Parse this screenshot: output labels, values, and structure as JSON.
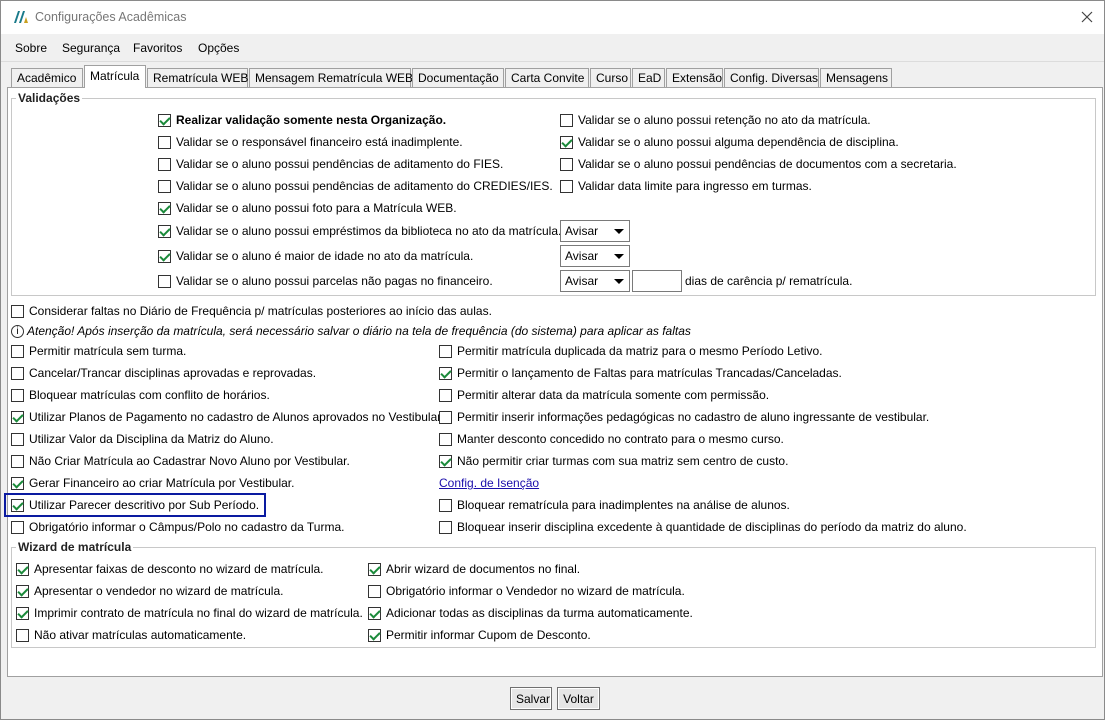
{
  "window": {
    "title": "Configurações Acadêmicas"
  },
  "menu": [
    "Sobre",
    "Segurança",
    "Favoritos",
    "Opções"
  ],
  "tabs": [
    "Acadêmico",
    "Matrícula",
    "Rematrícula WEB",
    "Mensagem Rematrícula WEB",
    "Documentação",
    "Carta Convite",
    "Curso",
    "EaD",
    "Extensão",
    "Config. Diversas",
    "Mensagens"
  ],
  "active_tab": "Matrícula",
  "validacoes": {
    "legend": "Validações",
    "left": [
      {
        "label": "Realizar validação somente nesta Organização.",
        "checked": true
      },
      {
        "label": "Validar se o responsável financeiro está inadimplente.",
        "checked": false
      },
      {
        "label": "Validar se o aluno possui pendências de aditamento do FIES.",
        "checked": false
      },
      {
        "label": "Validar se o aluno possui pendências de aditamento do CREDIES/IES.",
        "checked": false
      },
      {
        "label": "Validar se o aluno possui foto para a Matrícula WEB.",
        "checked": true
      },
      {
        "label": "Validar se o aluno possui empréstimos da biblioteca no ato da matrícula.",
        "checked": true
      },
      {
        "label": "Validar se o aluno é maior de idade no ato da matrícula.",
        "checked": true
      },
      {
        "label": "Validar se o aluno possui parcelas não pagas no financeiro.",
        "checked": false
      }
    ],
    "right": [
      {
        "label": "Validar se o aluno possui retenção no ato da matrícula.",
        "checked": false
      },
      {
        "label": "Validar se o aluno possui alguma dependência de disciplina.",
        "checked": true
      },
      {
        "label": "Validar se o aluno possui pendências de documentos com a secretaria.",
        "checked": false
      },
      {
        "label": "Validar data limite para ingresso em turmas.",
        "checked": false
      }
    ],
    "selects": [
      "Avisar",
      "Avisar",
      "Avisar"
    ],
    "dias_label": "dias de carência p/ rematrícula."
  },
  "faltas": {
    "label": "Considerar faltas no Diário de Frequência p/ matrículas posteriores ao início das aulas.",
    "checked": false
  },
  "atencao": "Atenção! Após inserção da matrícula, será necessário salvar o diário na tela de frequência (do sistema) para aplicar as faltas",
  "options_left": [
    {
      "label": "Permitir matrícula sem turma.",
      "checked": false
    },
    {
      "label": "Cancelar/Trancar disciplinas aprovadas e reprovadas.",
      "checked": false
    },
    {
      "label": "Bloquear matrículas com conflito de horários.",
      "checked": false
    },
    {
      "label": "Utilizar Planos de Pagamento no cadastro de Alunos aprovados no Vestibular.",
      "checked": true
    },
    {
      "label": "Utilizar Valor da Disciplina da Matriz do Aluno.",
      "checked": false
    },
    {
      "label": "Não Criar Matrícula ao Cadastrar Novo Aluno por Vestibular.",
      "checked": false
    },
    {
      "label": "Gerar Financeiro ao criar Matrícula por Vestibular.",
      "checked": true
    },
    {
      "label": "Utilizar Parecer descritivo por Sub Período.",
      "checked": true
    },
    {
      "label": "Obrigatório informar o Câmpus/Polo no cadastro da Turma.",
      "checked": false
    }
  ],
  "options_right": [
    {
      "label": "Permitir matrícula duplicada da matriz para o mesmo Período Letivo.",
      "checked": false
    },
    {
      "label": "Permitir o lançamento de Faltas para matrículas Trancadas/Canceladas.",
      "checked": true
    },
    {
      "label": "Permitir alterar data da matrícula somente com permissão.",
      "checked": false
    },
    {
      "label": "Permitir inserir informações pedagógicas no cadastro de aluno ingressante de vestibular.",
      "checked": false
    },
    {
      "label": "Manter desconto concedido no contrato para o mesmo curso.",
      "checked": false
    },
    {
      "label": "Não permitir criar turmas com sua matriz sem centro de custo.",
      "checked": true
    },
    {
      "label": "Bloquear rematrícula para inadimplentes na análise de alunos.",
      "checked": false
    },
    {
      "label": "Bloquear inserir disciplina excedente à quantidade de disciplinas do período da matriz do aluno.",
      "checked": false
    }
  ],
  "config_link": "Config. de Isenção",
  "wizard": {
    "legend": "Wizard de matrícula",
    "left": [
      {
        "label": "Apresentar faixas de desconto no wizard de matrícula.",
        "checked": true
      },
      {
        "label": "Apresentar o vendedor no wizard de matrícula.",
        "checked": true
      },
      {
        "label": "Imprimir contrato de matrícula no final do wizard de matrícula.",
        "checked": true
      },
      {
        "label": "Não ativar matrículas automaticamente.",
        "checked": false
      }
    ],
    "right": [
      {
        "label": "Abrir wizard de documentos no final.",
        "checked": true
      },
      {
        "label": "Obrigatório informar o Vendedor no wizard de matrícula.",
        "checked": false
      },
      {
        "label": "Adicionar todas as disciplinas da turma automaticamente.",
        "checked": true
      },
      {
        "label": "Permitir informar Cupom de Desconto.",
        "checked": true
      }
    ]
  },
  "buttons": {
    "save": "Salvar",
    "back": "Voltar"
  },
  "colors": {
    "highlight": "#0a1aa0",
    "check": "#1a8a3a",
    "link": "#1a0dab"
  }
}
